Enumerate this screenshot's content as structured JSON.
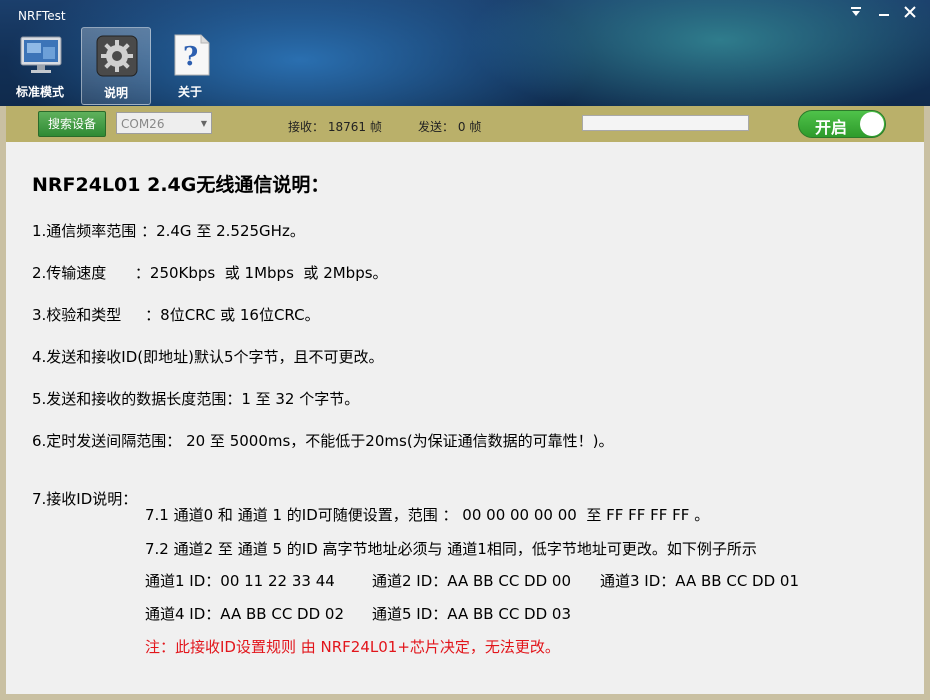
{
  "window": {
    "title": "NRFTest",
    "controls": [
      "pin-icon",
      "minimize-icon",
      "close-icon"
    ]
  },
  "toolbar": {
    "items": [
      {
        "label": "标准模式",
        "icon": "monitor-icon",
        "active": false
      },
      {
        "label": "说明",
        "icon": "gear-icon",
        "active": true
      },
      {
        "label": "关于",
        "icon": "help-document-icon",
        "active": false
      }
    ]
  },
  "statusbar": {
    "search_button": "搜索设备",
    "com_port": "COM26",
    "received_label": "接收：",
    "received_count": "18761",
    "received_unit": "帧",
    "sent_label": "发送：",
    "sent_count": "0",
    "sent_unit": "帧",
    "toggle_label": "开启"
  },
  "content": {
    "title": "NRF24L01 2.4G无线通信说明：",
    "items": [
      "1.通信频率范围 ：2.4G 至 2.525GHz。",
      "2.传输速度      ：250Kbps  或 1Mbps  或 2Mbps。",
      "3.校验和类型     ：8位CRC 或 16位CRC。",
      "4.发送和接收ID(即地址)默认5个字节，且不可更改。",
      "5.发送和接收的数据长度范围：1 至 32 个字节。",
      "6.定时发送间隔范围： 20 至 5000ms，不能低于20ms(为保证通信数据的可靠性！)。"
    ],
    "section7": {
      "heading": "7.接收ID说明：",
      "line1": "7.1 通道0 和 通道 1 的ID可随便设置，范围 ： 00 00 00 00 00  至 FF FF FF FF 。",
      "line2": "7.2 通道2 至 通道 5 的ID 高字节地址必须与 通道1相同，低字节地址可更改。如下例子所示",
      "ch1": "通道1 ID：00 11 22 33 44",
      "ch2": "通道2 ID：AA BB CC DD 00",
      "ch3": "通道3 ID：AA BB CC DD 01",
      "ch4": "通道4 ID：AA BB CC DD 02",
      "ch5": "通道5 ID：AA BB CC DD 03",
      "note": "注：此接收ID设置规则 由 NRF24L01+芯片决定，无法更改。"
    }
  },
  "colors": {
    "statusbar": "#bab06a",
    "accent_green": "#3aae36",
    "note_red": "#e2151b"
  }
}
